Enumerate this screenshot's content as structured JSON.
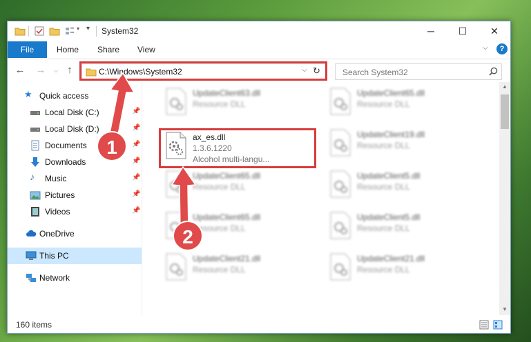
{
  "window": {
    "title": "System32",
    "minimize": "─",
    "maximize": "☐",
    "close": "✕"
  },
  "ribbon": {
    "tabs": [
      "File",
      "Home",
      "Share",
      "View"
    ],
    "help": "?"
  },
  "nav": {
    "address": "C:\\Windows\\System32",
    "search_placeholder": "Search System32"
  },
  "sidebar": {
    "items": [
      {
        "label": "Quick access",
        "icon": "star-icon"
      },
      {
        "label": "Local Disk (C:)",
        "icon": "drive-icon",
        "pinned": true
      },
      {
        "label": "Local Disk (D:)",
        "icon": "drive-icon",
        "pinned": true
      },
      {
        "label": "Documents",
        "icon": "document-icon",
        "pinned": true
      },
      {
        "label": "Downloads",
        "icon": "download-icon",
        "pinned": true
      },
      {
        "label": "Music",
        "icon": "music-icon",
        "pinned": true
      },
      {
        "label": "Pictures",
        "icon": "pictures-icon",
        "pinned": true
      },
      {
        "label": "Videos",
        "icon": "video-icon",
        "pinned": true
      },
      {
        "label": "OneDrive",
        "icon": "cloud-icon"
      },
      {
        "label": "This PC",
        "icon": "computer-icon",
        "selected": true
      },
      {
        "label": "Network",
        "icon": "network-icon"
      }
    ]
  },
  "files": {
    "focus": {
      "name": "ax_es.dll",
      "version": "1.3.6.1220",
      "description": "Alcohol multi-langu..."
    },
    "background": [
      {
        "name": "UpdateClient63.dll",
        "type": "Resource DLL"
      },
      {
        "name": "UpdateClient65.dll",
        "type": "Resource DLL"
      },
      {
        "name": "UpdateClient19.dll",
        "type": "Resource DLL"
      },
      {
        "name": "UpdateClient65.dll",
        "type": "Resource DLL"
      },
      {
        "name": "UpdateClient5.dll",
        "type": "Resource DLL"
      },
      {
        "name": "UpdateClient65.dll",
        "type": "Resource DLL"
      },
      {
        "name": "UpdateClient5.dll",
        "type": "Resource DLL"
      },
      {
        "name": "UpdateClient21.dll",
        "type": "Resource DLL"
      },
      {
        "name": "UpdateClient21.dll",
        "type": "Resource DLL"
      }
    ]
  },
  "status": {
    "item_count": "160 items"
  },
  "annotations": {
    "step1": "1",
    "step2": "2"
  },
  "colors": {
    "accent": "#1979ca",
    "highlight": "#d83c3c",
    "selection": "#cce8ff"
  }
}
